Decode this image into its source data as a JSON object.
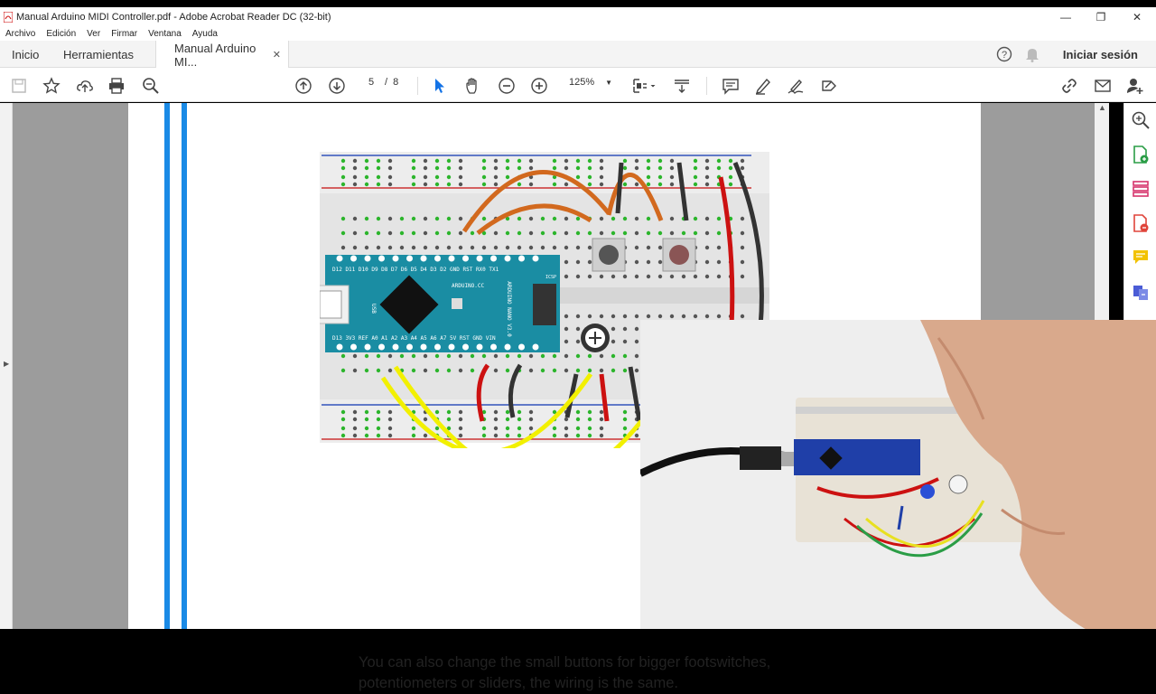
{
  "window": {
    "title": "Manual Arduino MIDI Controller.pdf - Adobe Acrobat Reader DC (32-bit)",
    "minimize": "—",
    "maximize": "❐",
    "close": "✕"
  },
  "menu": [
    "Archivo",
    "Edición",
    "Ver",
    "Firmar",
    "Ventana",
    "Ayuda"
  ],
  "tabs": {
    "home": "Inicio",
    "tools": "Herramientas",
    "document": "Manual Arduino MI...",
    "close": "✕",
    "signin": "Iniciar sesión"
  },
  "toolbar": {
    "current_page": "5",
    "page_sep": "/",
    "total_pages": "8",
    "zoom": "125%"
  },
  "page": {
    "text_line1": "You can also change the small buttons for bigger footswitches,",
    "text_line2": "potentiometers or sliders, the wiring is the same."
  },
  "board": {
    "name": "ARDUINO NANO V3.0",
    "pins_top": "D12 D11 D10 D9 D8 D7 D6 D5 D4 D3 D2 GND RST RX0 TX1",
    "pins_bottom": "D13 3V3 REF A0 A1 A2 A3 A4 A5 A6 A7 5V RST GND VIN",
    "brand": "ARDUINO.CC",
    "usb": "USB",
    "icsp": "ICSP"
  },
  "colors": {
    "accent_blue": "#1a8ae6",
    "wire_orange": "#d2691e",
    "wire_yellow": "#f2f000",
    "wire_red": "#cc1111",
    "board_teal": "#1a8da3"
  }
}
